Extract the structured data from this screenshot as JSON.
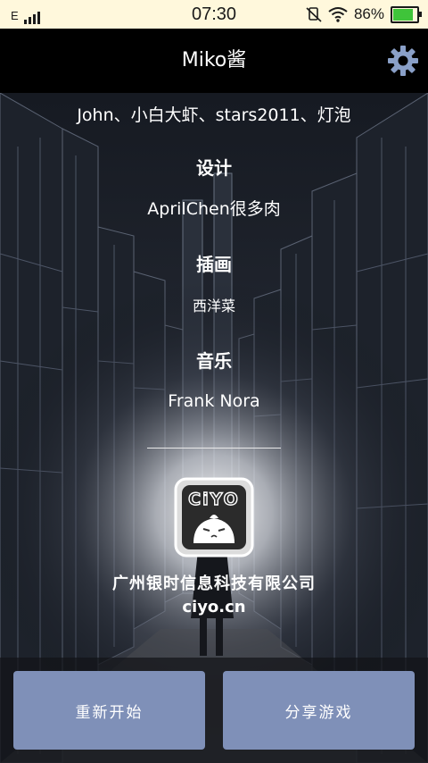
{
  "status_bar": {
    "network": "E",
    "time": "07:30",
    "battery_percent": "86%",
    "battery_level": 0.86,
    "icons": [
      "signal-icon",
      "mute-icon",
      "wifi-icon",
      "battery-icon"
    ]
  },
  "header": {
    "title": "Miko酱",
    "settings_icon": "gear-icon"
  },
  "credits": {
    "names": "John、小白大虾、stars2011、灯泡",
    "sections": [
      {
        "heading": "设计",
        "value": "AprilChen很多肉"
      },
      {
        "heading": "插画",
        "value": "西洋菜"
      },
      {
        "heading": "音乐",
        "value": "Frank Nora"
      }
    ]
  },
  "studio": {
    "logo_text": "CiYO",
    "company": "广州银时信息科技有限公司",
    "website": "ciyo.cn"
  },
  "buttons": {
    "restart": "重新开始",
    "share": "分享游戏"
  },
  "colors": {
    "status_bar_bg": "#fff8dc",
    "title_bar_bg": "#000000",
    "button_bg": "#7f90b8",
    "battery_fill": "#3fc43a"
  }
}
